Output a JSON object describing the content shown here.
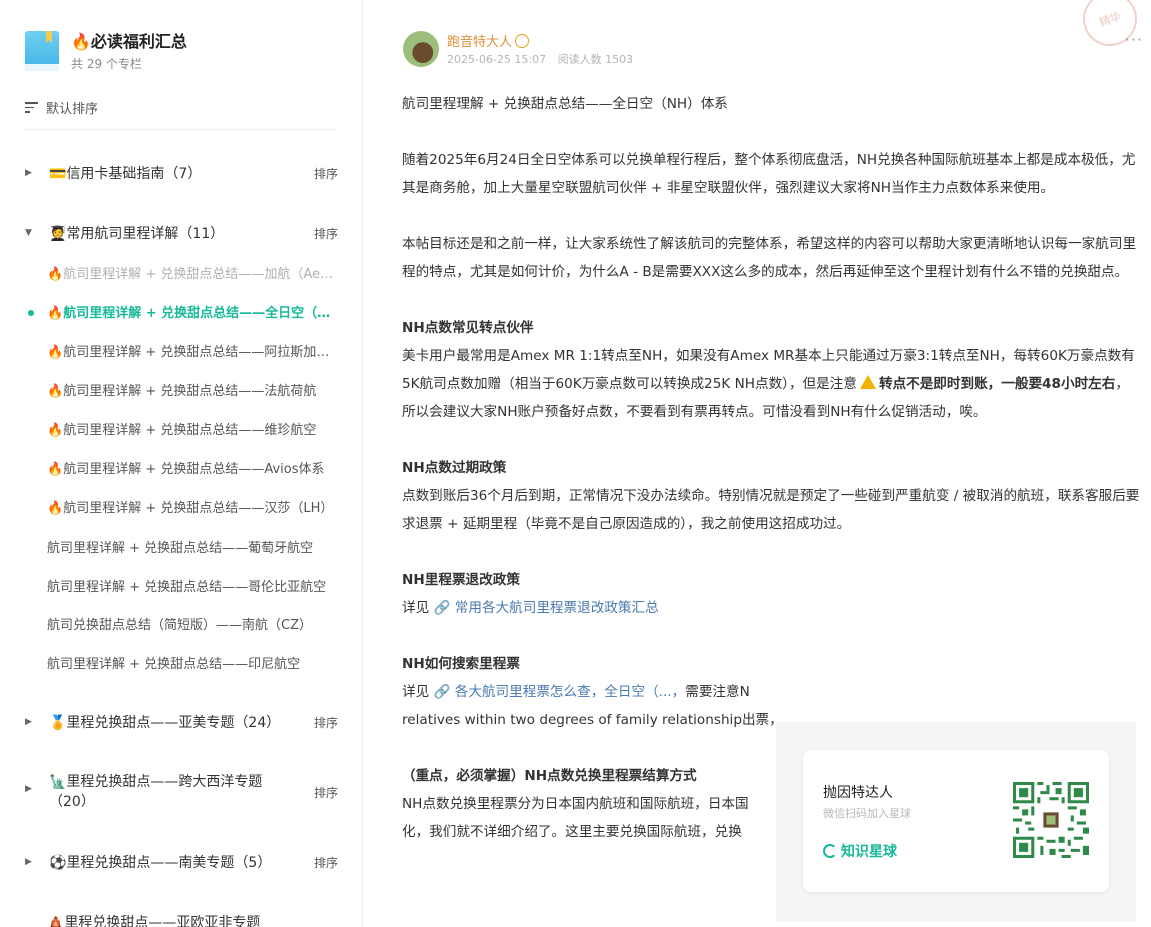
{
  "sidebar": {
    "title": "必读福利汇总",
    "subtitle": "共 29 个专栏",
    "sort_label": "默认排序",
    "groups": [
      {
        "name": "💳信用卡基础指南（7）",
        "sort": "排序"
      },
      {
        "name": "🧑‍🎓常用航司里程详解（11）",
        "sort": "排序"
      },
      {
        "name": "🏅里程兑换甜点——亚美专题（24）",
        "sort": "排序"
      },
      {
        "name": "🗽里程兑换甜点——跨大西洋专题",
        "name2": "（20）",
        "sort": "排序"
      },
      {
        "name": "⚽里程兑换甜点——南美专题（5）",
        "sort": "排序"
      },
      {
        "name": "🛕里程兑换甜点——亚欧亚非专题"
      }
    ],
    "items": [
      "航司里程详解 + 兑换甜点总结——加航（Aeroplan）",
      "航司里程详解 + 兑换甜点总结——全日空（NH）体系",
      "航司里程详解 + 兑换甜点总结——阿拉斯加航空",
      "航司里程详解 + 兑换甜点总结——法航荷航",
      "航司里程详解 + 兑换甜点总结——维珍航空",
      "航司里程详解 + 兑换甜点总结——Avios体系",
      "航司里程详解 + 兑换甜点总结——汉莎（LH）",
      "航司里程详解 + 兑换甜点总结——葡萄牙航空",
      "航司里程详解 + 兑换甜点总结——哥伦比亚航空",
      "航司兑换甜点总结（简短版）——南航（CZ）",
      "航司里程详解 + 兑换甜点总结——印尼航空"
    ]
  },
  "post": {
    "author": "跑音特大人",
    "date": "2025-06-25 15:07",
    "reads": "阅读人数 1503",
    "more": "···",
    "stamp": "精华",
    "title_line": "航司里程理解 + 兑换甜点总结——全日空（NH）体系",
    "p1": "随着2025年6月24日全日空体系可以兑换单程行程后，整个体系彻底盘活，NH兑换各种国际航班基本上都是成本极低，尤其是商务舱，加上大量星空联盟航司伙伴 + 非星空联盟伙伴，强烈建议大家将NH当作主力点数体系来使用。",
    "p2": "本帖目标还是和之前一样，让大家系统性了解该航司的完整体系，希望这样的内容可以帮助大家更清晰地认识每一家航司里程的特点，尤其是如何计价，为什么A - B是需要XXX这么多的成本，然后再延伸至这个里程计划有什么不错的兑换甜点。",
    "h1": "NH点数常见转点伙伴",
    "p3a": "美卡用户最常用是Amex MR 1:1转点至NH，如果没有Amex MR基本上只能通过万豪3:1转点至NH，每转60K万豪点数有5K航司点数加赠（相当于60K万豪点数可以转换成25K NH点数），但是注意",
    "p3b": "转点不是即时到账，一般要48小时左右",
    "p3c": "，所以会建议大家NH账户预备好点数，不要看到有票再转点。可惜没看到NH有什么促销活动，唉。",
    "h2": "NH点数过期政策",
    "p4": "点数到账后36个月后到期，正常情况下没办法续命。特别情况就是预定了一些碰到严重航变 / 被取消的航班，联系客服后要求退票 + 延期里程（毕竟不是自己原因造成的），我之前使用这招成功过。",
    "h3": "NH里程票退改政策",
    "p5_prefix": "详见",
    "p5_link": "🔗 常用各大航司里程票退改政策汇总",
    "h4": "NH如何搜索里程票",
    "p6_prefix": "详见",
    "p6_link": "🔗 各大航司里程票怎么查，全日空（...，",
    "p6_rest": "需要注意N",
    "p6_line2": "relatives within two degrees of family relationship出票，",
    "h5": "（重点，必须掌握）NH点数兑换里程票结算方式",
    "p7_line1": "NH点数兑换里程票分为日本国内航班和国际航班，日本国",
    "p7_line2": "化，我们就不详细介绍了。这里主要兑换国际航班，兑换"
  },
  "qr": {
    "name": "抛因特达人",
    "sub": "微信扫码加入星球",
    "brand": "知识星球"
  },
  "colors": {
    "accent": "#16b998",
    "author": "#e0903a",
    "link": "#4a7ab0"
  }
}
